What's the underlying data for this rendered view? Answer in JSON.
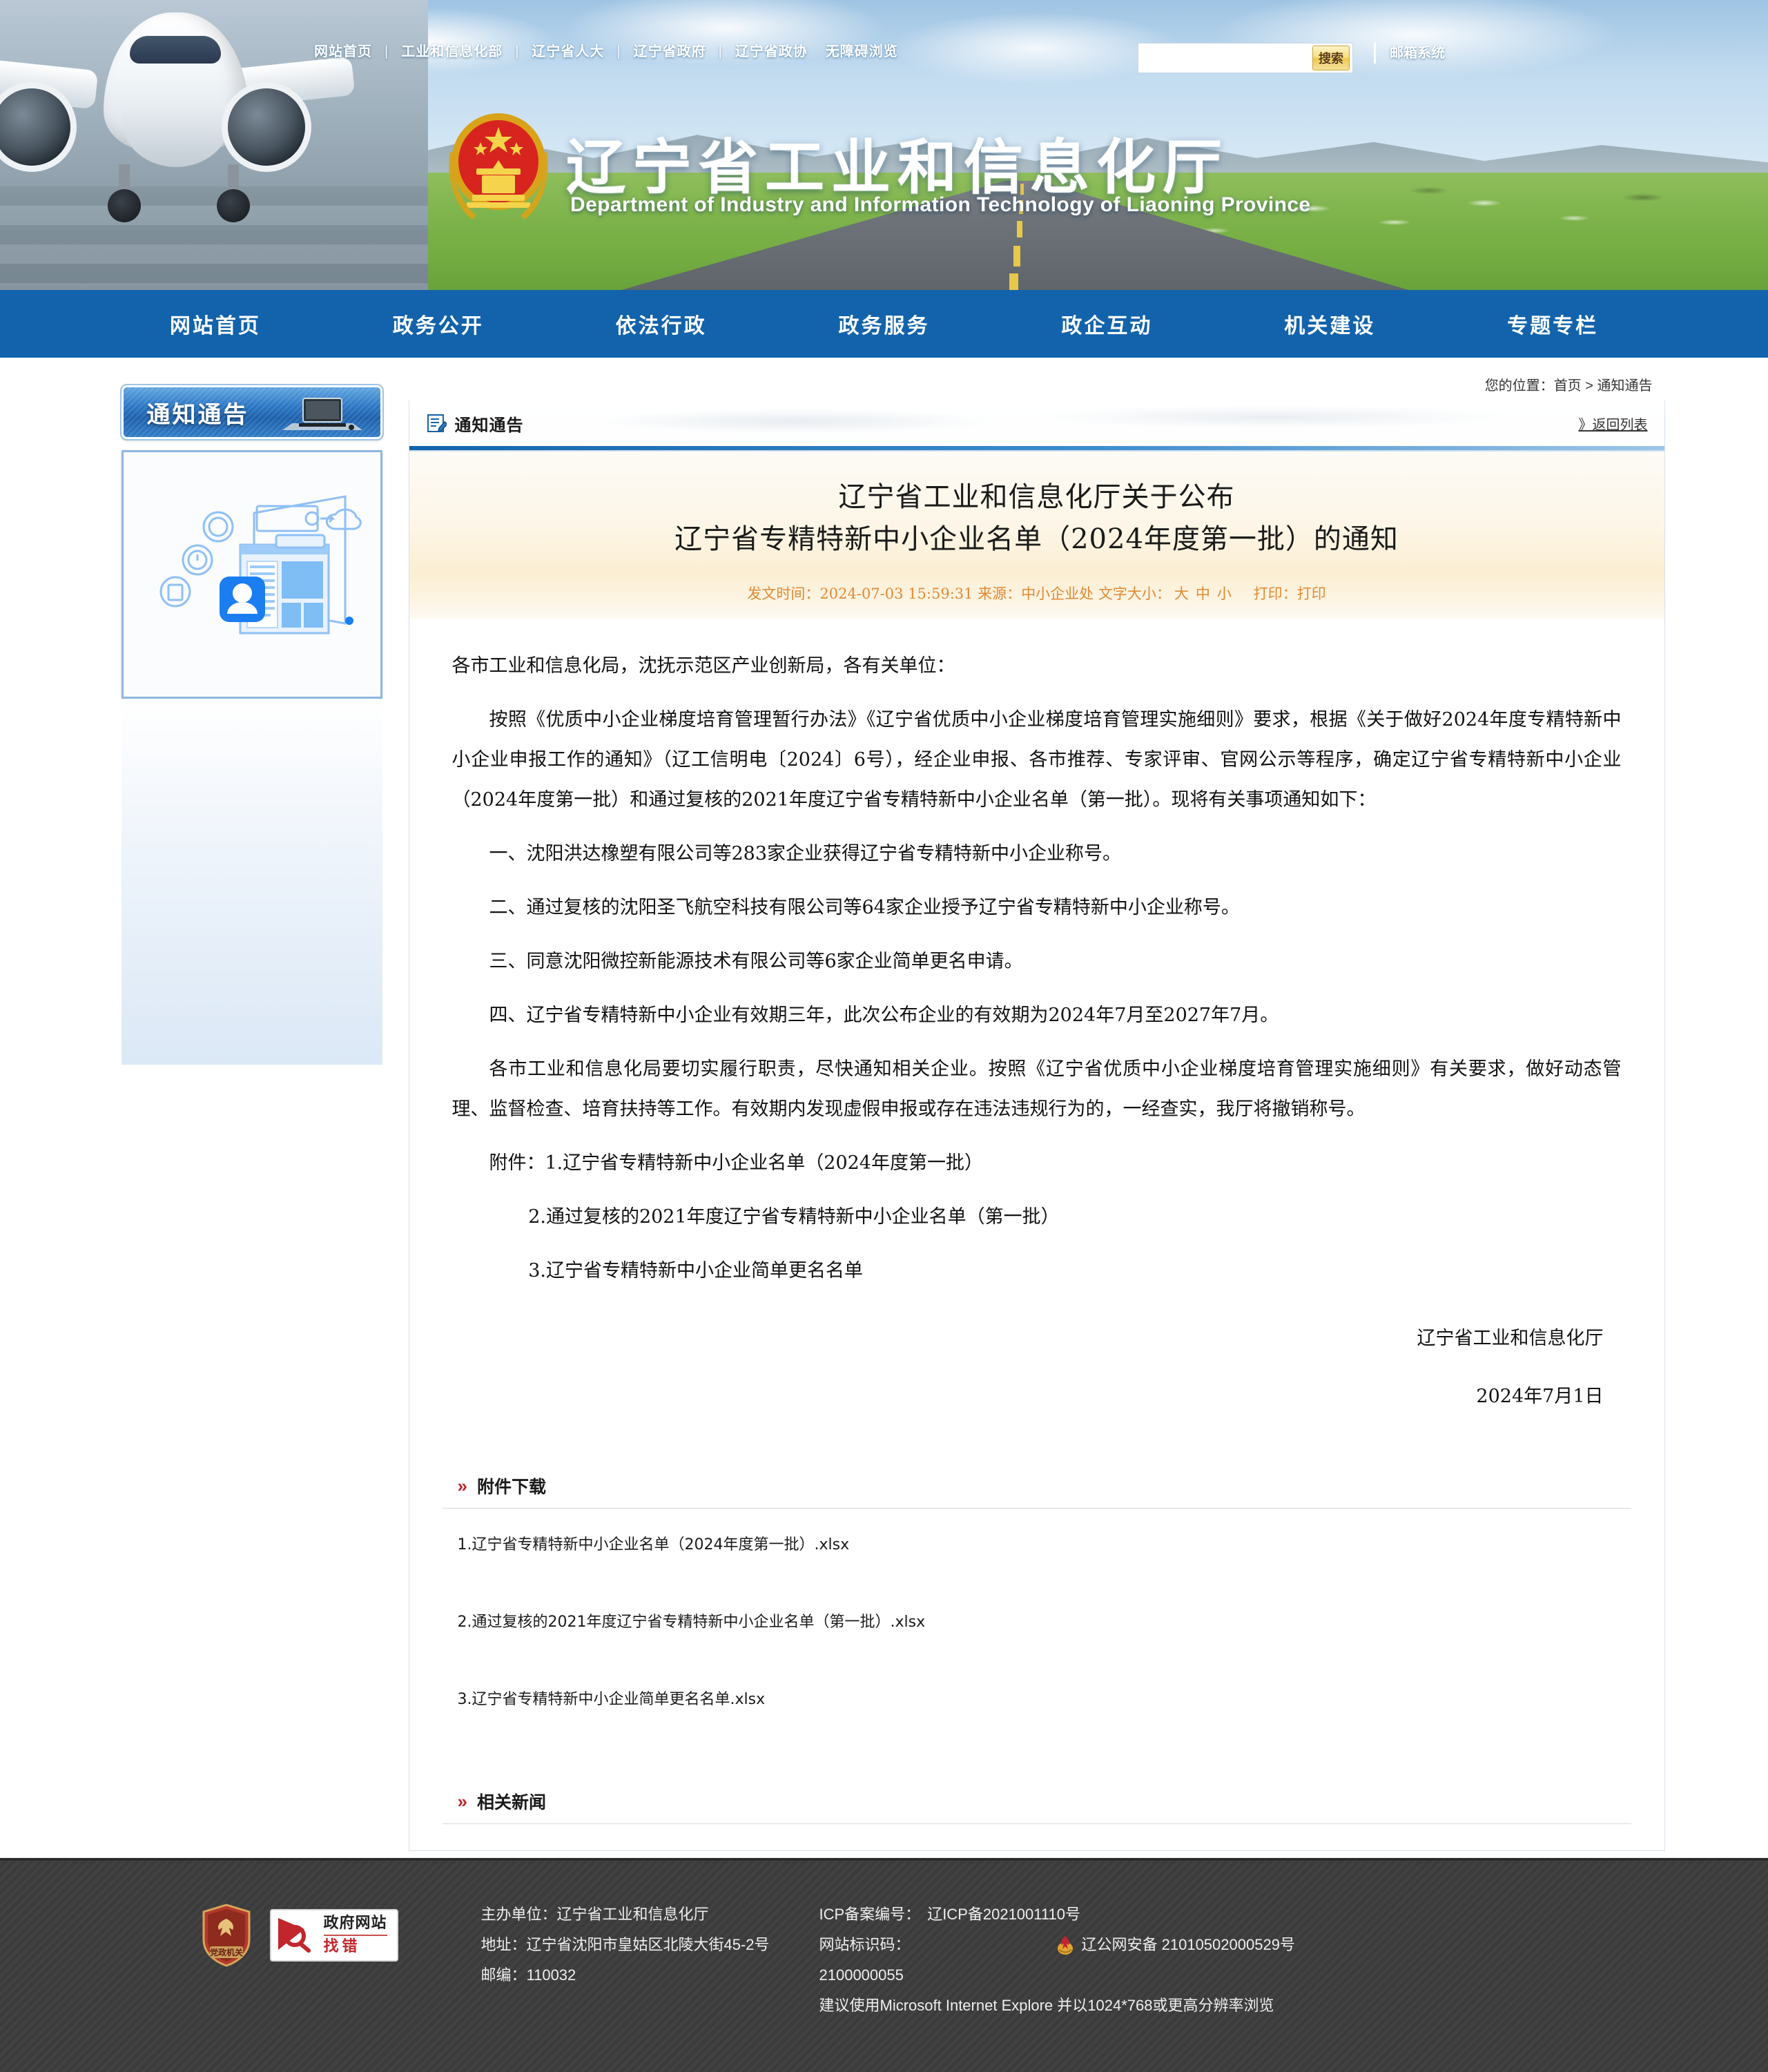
{
  "topbar": {
    "links": [
      "网站首页",
      "工业和信息化部",
      "辽宁省人大",
      "辽宁省政府",
      "辽宁省政协"
    ],
    "accessibility": "无障碍浏览",
    "separator": "|",
    "search": {
      "placeholder": "",
      "value": "",
      "button_label": "搜索"
    },
    "mail_system": "邮箱系统"
  },
  "header": {
    "title": "辽宁省工业和信息化厅",
    "subtitle": "Department of Industry and Information Technology of Liaoning Province",
    "emblem_icon": "china-national-emblem-icon"
  },
  "mainnav": {
    "items": [
      "网站首页",
      "政务公开",
      "依法行政",
      "政务服务",
      "政企互动",
      "机关建设",
      "专题专栏"
    ]
  },
  "sidebar": {
    "heading": "通知通告",
    "heading_icon": "laptop-icon",
    "illustration_icon": "notice-illustration-icon"
  },
  "breadcrumb": {
    "prefix": "您的位置：",
    "home": "首页",
    "sep": ">",
    "current": "通知通告"
  },
  "panel": {
    "icon": "notice-pen-icon",
    "title": "通知通告",
    "back_link": "》返回列表"
  },
  "article": {
    "title_line1": "辽宁省工业和信息化厅关于公布",
    "title_line2": "辽宁省专精特新中小企业名单（2024年度第一批）的通知",
    "meta": {
      "publish_label": "发文时间：",
      "publish_time": "2024-07-03 15:59:31",
      "source_label": "来源：",
      "source": "中小企业处",
      "fontsize_label": "文字大小：",
      "fontsize_options": [
        "大",
        "中",
        "小"
      ],
      "print_label": "打印：",
      "print_link": "打印"
    },
    "paragraphs": [
      {
        "indent": false,
        "text": "各市工业和信息化局，沈抚示范区产业创新局，各有关单位："
      },
      {
        "indent": true,
        "text": "按照《优质中小企业梯度培育管理暂行办法》《辽宁省优质中小企业梯度培育管理实施细则》要求，根据《关于做好2024年度专精特新中小企业申报工作的通知》（辽工信明电〔2024〕6号），经企业申报、各市推荐、专家评审、官网公示等程序，确定辽宁省专精特新中小企业（2024年度第一批）和通过复核的2021年度辽宁省专精特新中小企业名单（第一批）。现将有关事项通知如下："
      },
      {
        "indent": true,
        "text": "一、沈阳洪达橡塑有限公司等283家企业获得辽宁省专精特新中小企业称号。"
      },
      {
        "indent": true,
        "text": "二、通过复核的沈阳圣飞航空科技有限公司等64家企业授予辽宁省专精特新中小企业称号。"
      },
      {
        "indent": true,
        "text": "三、同意沈阳微控新能源技术有限公司等6家企业简单更名申请。"
      },
      {
        "indent": true,
        "text": "四、辽宁省专精特新中小企业有效期三年，此次公布企业的有效期为2024年7月至2027年7月。"
      },
      {
        "indent": true,
        "text": "各市工业和信息化局要切实履行职责，尽快通知相关企业。按照《辽宁省优质中小企业梯度培育管理实施细则》有关要求，做好动态管理、监督检查、培育扶持等工作。有效期内发现虚假申报或存在违法违规行为的，一经查实，我厅将撤销称号。"
      }
    ],
    "enclosures": [
      {
        "style": "att",
        "text": "附件：1.辽宁省专精特新中小企业名单（2024年度第一批）"
      },
      {
        "style": "att2",
        "text": "2.通过复核的2021年度辽宁省专精特新中小企业名单（第一批）"
      },
      {
        "style": "att2",
        "text": "3.辽宁省专精特新中小企业简单更名名单"
      }
    ],
    "signature": "辽宁省工业和信息化厅",
    "signature_date": "2024年7月1日"
  },
  "attachments_section": {
    "heading": "附件下载",
    "chevron_icon": "double-chevron-right-icon",
    "files": [
      "1.辽宁省专精特新中小企业名单（2024年度第一批）.xlsx",
      "2.通过复核的2021年度辽宁省专精特新中小企业名单（第一批）.xlsx",
      "3.辽宁省专精特新中小企业简单更名名单.xlsx"
    ]
  },
  "related_section": {
    "heading": "相关新闻",
    "chevron_icon": "double-chevron-right-icon"
  },
  "footer": {
    "badge_party": "党政机关",
    "badge_zhaocuo_top": "政府网站",
    "badge_zhaocuo_bottom": "找错",
    "col1": [
      "主办单位：辽宁省工业和信息化厅",
      "地址：辽宁省沈阳市皇姑区北陵大街45-2号",
      "邮编：110032"
    ],
    "icp_label": "ICP备案编号：",
    "icp_value": "辽ICP备2021001110号",
    "site_code_label": "网站标识码：",
    "site_code_value": "2100000055",
    "police_icon": "police-badge-icon",
    "police_record": "辽公网安备 21010502000529号",
    "browser_tip": "建议使用Microsoft Internet Explore 并以1024*768或更高分辨率浏览"
  },
  "colors": {
    "nav_blue": "#1263ab",
    "accent_red": "#c0262c",
    "meta_orange": "#e08a33",
    "footer_dark": "#3b3b3b"
  }
}
